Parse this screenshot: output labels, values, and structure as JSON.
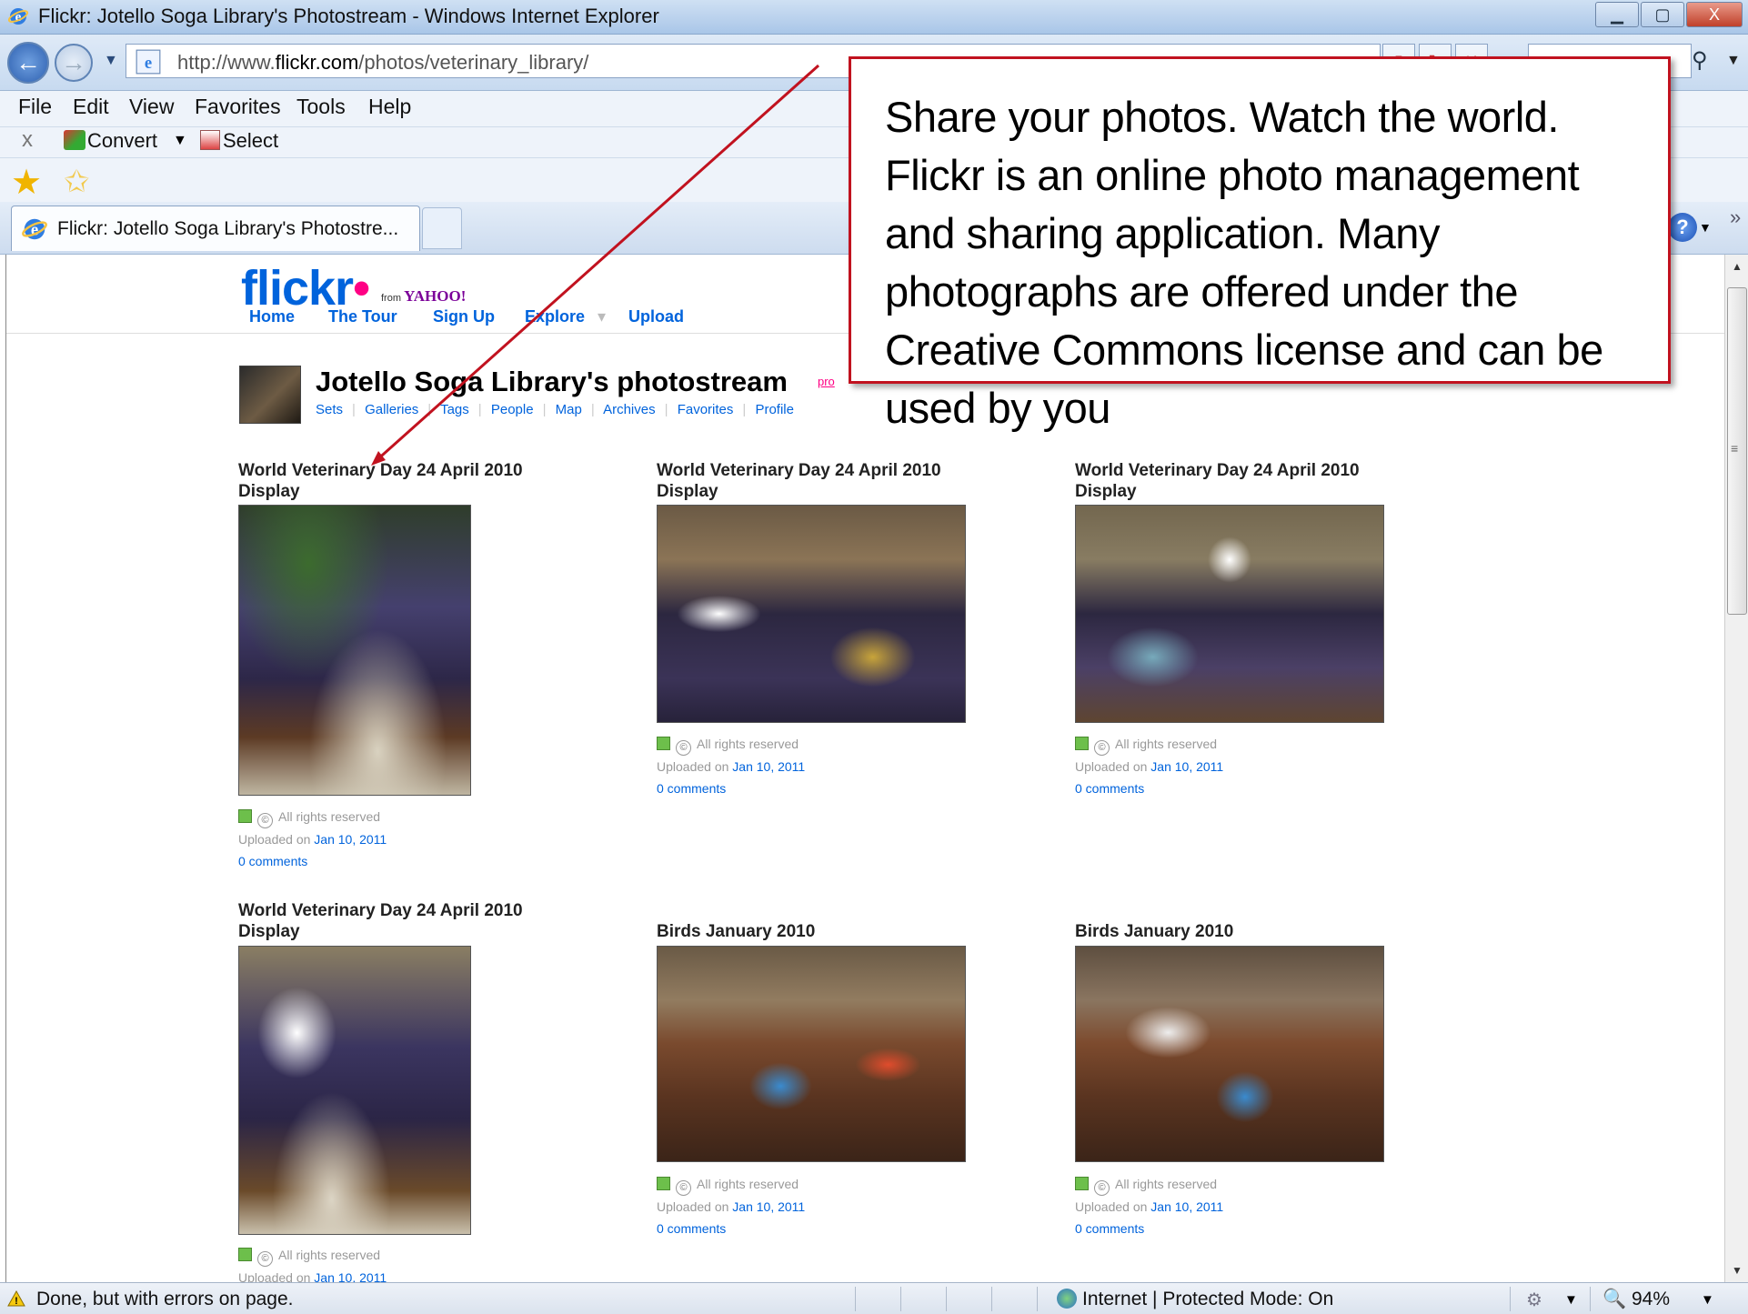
{
  "window": {
    "title": "Flickr: Jotello Soga Library's Photostream - Windows Internet Explorer",
    "min": "▁",
    "max": "▢",
    "close": "X"
  },
  "address": {
    "url_prefix": "http://www.",
    "url_domain": "flickr.com",
    "url_path": "/photos/veterinary_library/"
  },
  "menu": {
    "file": "File",
    "edit": "Edit",
    "view": "View",
    "favorites": "Favorites",
    "tools": "Tools",
    "help": "Help"
  },
  "convert_bar": {
    "close": "x",
    "convert": "Convert",
    "select": "Select"
  },
  "tab": {
    "label": "Flickr: Jotello Soga Library's Photostre..."
  },
  "flickr": {
    "logo_main": "flickr",
    "logo_from": "from",
    "logo_yahoo": "YAHOO!",
    "nav": {
      "home": "Home",
      "tour": "The Tour",
      "signup": "Sign Up",
      "explore": "Explore",
      "upload": "Upload"
    },
    "photostream_title": "Jotello Soga Library's photostream",
    "pro_badge": "pro",
    "subnav": [
      "Sets",
      "Galleries",
      "Tags",
      "People",
      "Map",
      "Archives",
      "Favorites",
      "Profile"
    ],
    "photos": [
      {
        "title_line1": "World Veterinary Day 24 April 2010",
        "title_line2": "Display",
        "rights": "All rights reserved",
        "uploaded_label": "Uploaded on",
        "uploaded_date": "Jan 10, 2011",
        "comments": "0 comments"
      },
      {
        "title_line1": "World Veterinary Day 24 April 2010",
        "title_line2": "Display",
        "rights": "All rights reserved",
        "uploaded_label": "Uploaded on",
        "uploaded_date": "Jan 10, 2011",
        "comments": "0 comments"
      },
      {
        "title_line1": "World Veterinary Day 24 April 2010",
        "title_line2": "Display",
        "rights": "All rights reserved",
        "uploaded_label": "Uploaded on",
        "uploaded_date": "Jan 10, 2011",
        "comments": "0 comments"
      },
      {
        "title_line1": "World Veterinary Day 24 April 2010",
        "title_line2": "Display",
        "rights": "All rights reserved",
        "uploaded_label": "Uploaded on",
        "uploaded_date": "Jan 10, 2011",
        "comments": ""
      },
      {
        "title_line1": "Birds January 2010",
        "title_line2": "",
        "rights": "All rights reserved",
        "uploaded_label": "Uploaded on",
        "uploaded_date": "Jan 10, 2011",
        "comments": "0 comments"
      },
      {
        "title_line1": "Birds January 2010",
        "title_line2": "",
        "rights": "All rights reserved",
        "uploaded_label": "Uploaded on",
        "uploaded_date": "Jan 10, 2011",
        "comments": "0 comments"
      }
    ]
  },
  "callout": {
    "text": "Share your photos. Watch the world. Flickr is an online photo management and sharing application. Many photographs are offered under the Creative Commons license and can be used by you"
  },
  "status": {
    "text": "Done, but with errors on page.",
    "zone": "Internet | Protected Mode: On",
    "zoom": "94%"
  },
  "colors": {
    "flickr_blue": "#0063dc",
    "flickr_pink": "#ff0084",
    "callout_border": "#c1121f"
  }
}
